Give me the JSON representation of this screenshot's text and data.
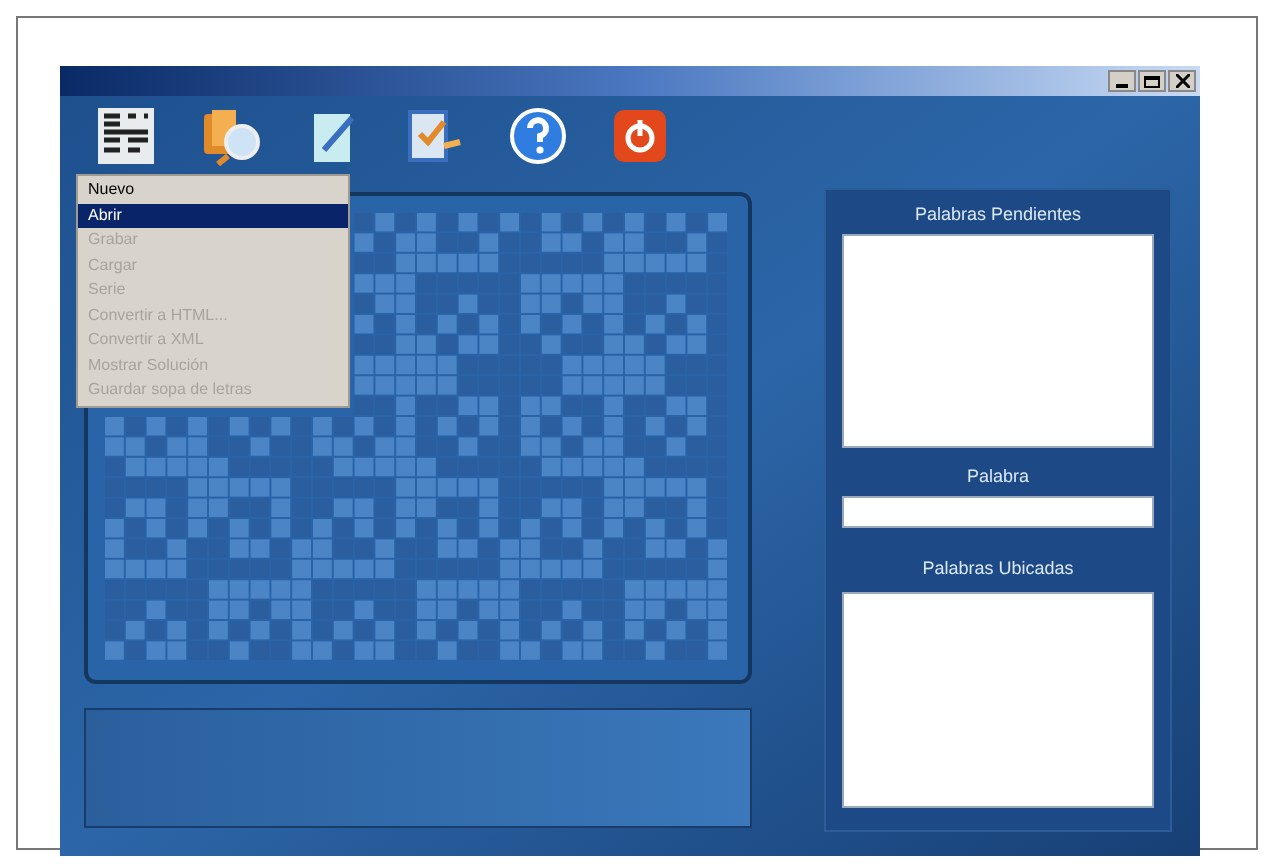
{
  "toolbar": [
    {
      "kind": "grid"
    },
    {
      "kind": "search"
    },
    {
      "kind": "note"
    },
    {
      "kind": "edit"
    },
    {
      "kind": "help"
    },
    {
      "kind": "power"
    }
  ],
  "menu": [
    {
      "label": "Nuevo",
      "selected": false,
      "disabled": false
    },
    {
      "label": "Abrir",
      "selected": true,
      "disabled": false
    },
    {
      "label": "Grabar",
      "selected": false,
      "disabled": true
    },
    {
      "label": "Cargar",
      "selected": false,
      "disabled": true
    },
    {
      "label": "Serie",
      "selected": false,
      "disabled": true
    },
    {
      "label": "Convertir a HTML...",
      "selected": false,
      "disabled": true
    },
    {
      "label": "Convertir a XML",
      "selected": false,
      "disabled": true
    },
    {
      "label": "Mostrar Solución",
      "selected": false,
      "disabled": true
    },
    {
      "label": "Guardar sopa de letras",
      "selected": false,
      "disabled": true
    }
  ],
  "right_panel": {
    "pending_title": "Palabras Pendientes",
    "word_label": "Palabra",
    "located_title": "Palabras Ubicadas"
  }
}
